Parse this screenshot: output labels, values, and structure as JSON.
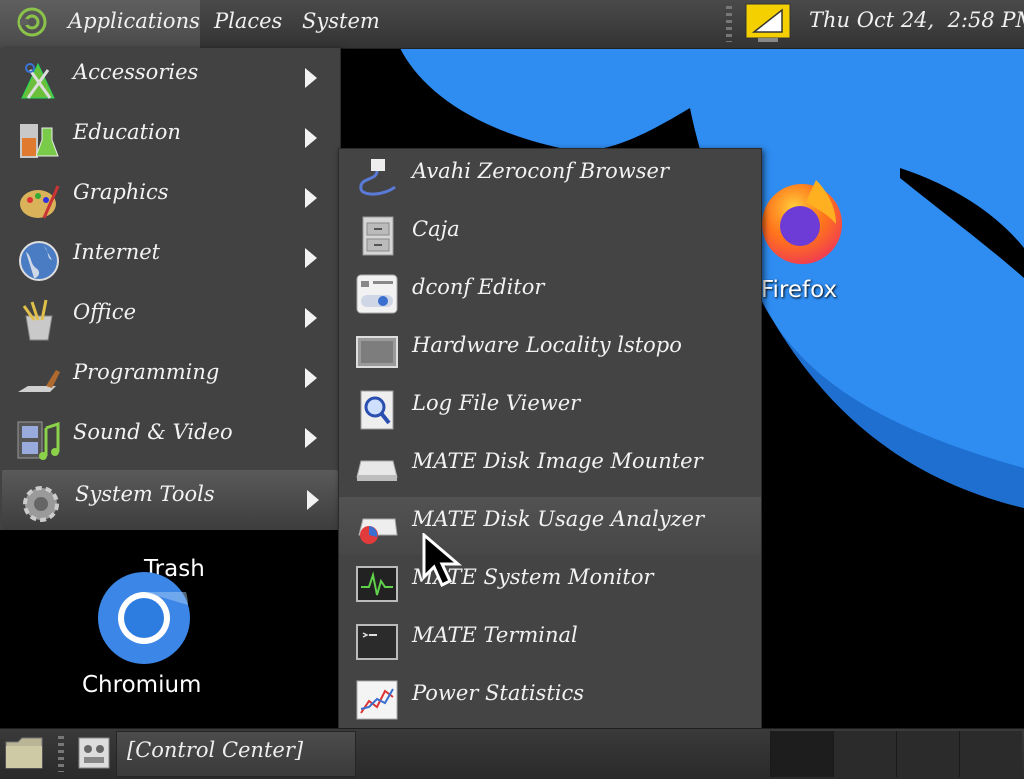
{
  "top_panel": {
    "applications": "Applications",
    "places": "Places",
    "system": "System",
    "clock": "Thu Oct 24,  2:58 PM"
  },
  "applications_menu": [
    {
      "label": "Accessories",
      "icon": "accessories-icon"
    },
    {
      "label": "Education",
      "icon": "education-icon"
    },
    {
      "label": "Graphics",
      "icon": "graphics-icon"
    },
    {
      "label": "Internet",
      "icon": "internet-icon"
    },
    {
      "label": "Office",
      "icon": "office-icon"
    },
    {
      "label": "Programming",
      "icon": "programming-icon"
    },
    {
      "label": "Sound & Video",
      "icon": "sound-video-icon"
    },
    {
      "label": "System Tools",
      "icon": "system-tools-icon",
      "active": true
    }
  ],
  "system_tools_menu": [
    {
      "label": "Avahi Zeroconf Browser",
      "icon": "avahi-icon"
    },
    {
      "label": "Caja",
      "icon": "file-cabinet-icon"
    },
    {
      "label": "dconf Editor",
      "icon": "dconf-icon"
    },
    {
      "label": "Hardware Locality lstopo",
      "icon": "hardware-icon"
    },
    {
      "label": "Log File Viewer",
      "icon": "log-viewer-icon"
    },
    {
      "label": "MATE Disk Image Mounter",
      "icon": "disk-mounter-icon"
    },
    {
      "label": "MATE Disk Usage Analyzer",
      "icon": "disk-usage-icon",
      "hover": true
    },
    {
      "label": "MATE System Monitor",
      "icon": "system-monitor-icon"
    },
    {
      "label": "MATE Terminal",
      "icon": "terminal-icon"
    },
    {
      "label": "Power Statistics",
      "icon": "power-stats-icon"
    }
  ],
  "desktop": {
    "firefox": "Firefox",
    "trash": "Trash",
    "chromium": "Chromium"
  },
  "bottom_panel": {
    "task": "[Control Center]"
  },
  "colors": {
    "wallpaper_blue": "#2f8cf0",
    "menu_bg": "#424242",
    "chromium_blue": "#3b86e6"
  }
}
